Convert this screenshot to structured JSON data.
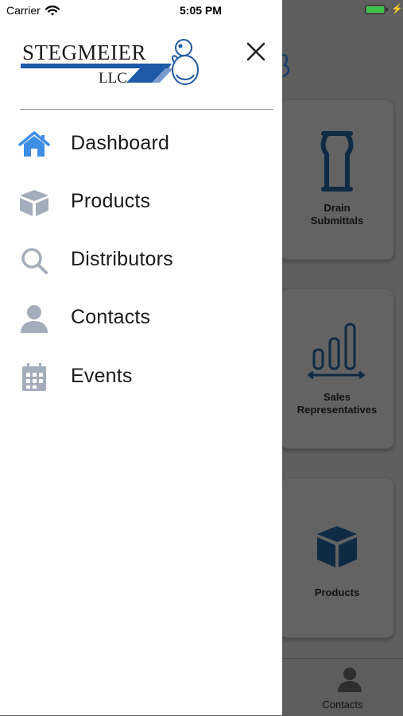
{
  "status_bar": {
    "carrier": "Carrier",
    "time": "5:05 PM"
  },
  "logo": {
    "brand": "STEGMEIER",
    "suffix": "LLC"
  },
  "menu": {
    "items": [
      {
        "label": "Dashboard",
        "icon": "home-icon"
      },
      {
        "label": "Products",
        "icon": "cube-icon"
      },
      {
        "label": "Distributors",
        "icon": "search-icon"
      },
      {
        "label": "Contacts",
        "icon": "person-icon"
      },
      {
        "label": "Events",
        "icon": "calendar-icon"
      }
    ]
  },
  "background": {
    "cards": [
      {
        "label": "Drain\nSubmittals",
        "icon": "drain-icon"
      },
      {
        "label": "Sales\nRepresentatives",
        "icon": "bar-chart-icon"
      },
      {
        "label": "Products",
        "icon": "cube-icon"
      }
    ],
    "tab_bar": {
      "label": "Contacts",
      "icon": "person-icon"
    }
  },
  "colors": {
    "accent_blue": "#1d5aa8",
    "icon_gray": "#a4adbb",
    "home_blue": "#3f8ee6",
    "overlay_gray": "#5f5f5f",
    "card_icon_navy": "#0e2a45"
  }
}
